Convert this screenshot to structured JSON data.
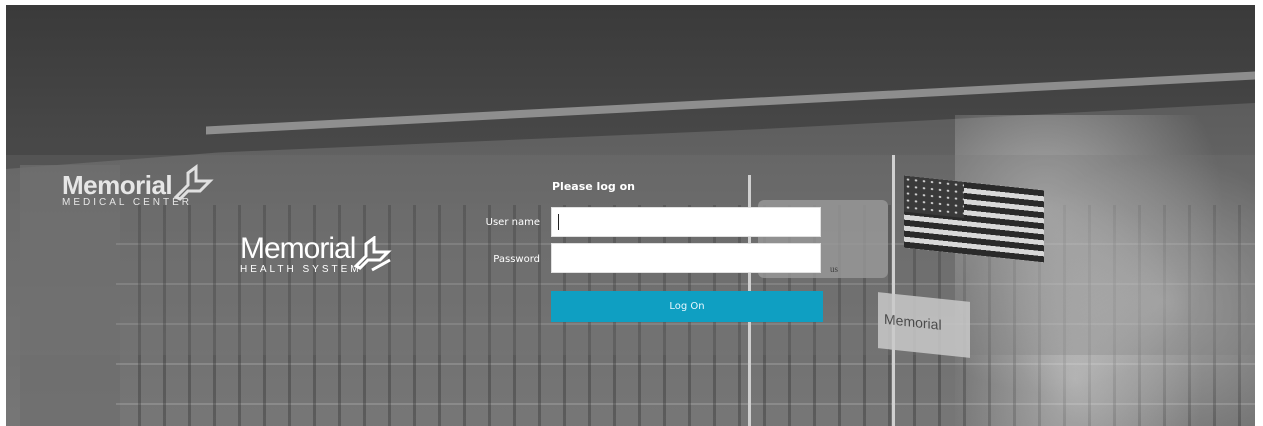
{
  "background": {
    "building_sign": {
      "line1": "Memorial",
      "line2": "MEDICAL CENTER"
    },
    "logo": {
      "line1": "Memorial",
      "line2": "HEALTH SYSTEM"
    },
    "flag_text": "Memorial",
    "fragment_text": "us"
  },
  "login": {
    "title": "Please log on",
    "username_label": "User name",
    "username_value": "",
    "password_label": "Password",
    "password_value": "",
    "submit_label": "Log On"
  },
  "colors": {
    "accent": "#0f9fc2"
  }
}
